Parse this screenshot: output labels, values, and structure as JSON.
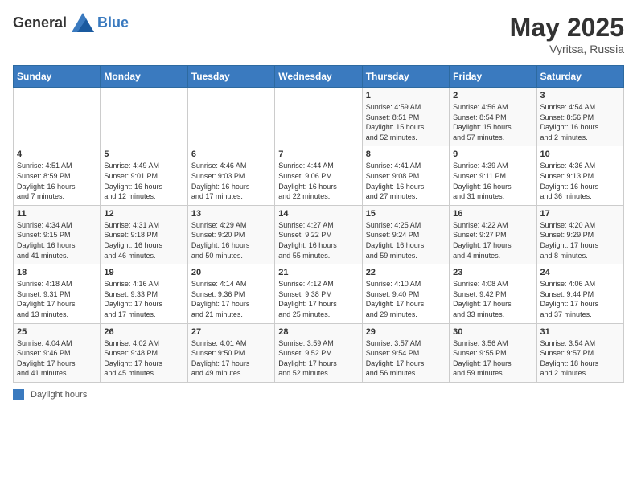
{
  "header": {
    "logo_general": "General",
    "logo_blue": "Blue",
    "title": "May 2025",
    "subtitle": "Vyritsa, Russia"
  },
  "weekdays": [
    "Sunday",
    "Monday",
    "Tuesday",
    "Wednesday",
    "Thursday",
    "Friday",
    "Saturday"
  ],
  "weeks": [
    [
      {
        "day": "",
        "info": ""
      },
      {
        "day": "",
        "info": ""
      },
      {
        "day": "",
        "info": ""
      },
      {
        "day": "",
        "info": ""
      },
      {
        "day": "1",
        "info": "Sunrise: 4:59 AM\nSunset: 8:51 PM\nDaylight: 15 hours\nand 52 minutes."
      },
      {
        "day": "2",
        "info": "Sunrise: 4:56 AM\nSunset: 8:54 PM\nDaylight: 15 hours\nand 57 minutes."
      },
      {
        "day": "3",
        "info": "Sunrise: 4:54 AM\nSunset: 8:56 PM\nDaylight: 16 hours\nand 2 minutes."
      }
    ],
    [
      {
        "day": "4",
        "info": "Sunrise: 4:51 AM\nSunset: 8:59 PM\nDaylight: 16 hours\nand 7 minutes."
      },
      {
        "day": "5",
        "info": "Sunrise: 4:49 AM\nSunset: 9:01 PM\nDaylight: 16 hours\nand 12 minutes."
      },
      {
        "day": "6",
        "info": "Sunrise: 4:46 AM\nSunset: 9:03 PM\nDaylight: 16 hours\nand 17 minutes."
      },
      {
        "day": "7",
        "info": "Sunrise: 4:44 AM\nSunset: 9:06 PM\nDaylight: 16 hours\nand 22 minutes."
      },
      {
        "day": "8",
        "info": "Sunrise: 4:41 AM\nSunset: 9:08 PM\nDaylight: 16 hours\nand 27 minutes."
      },
      {
        "day": "9",
        "info": "Sunrise: 4:39 AM\nSunset: 9:11 PM\nDaylight: 16 hours\nand 31 minutes."
      },
      {
        "day": "10",
        "info": "Sunrise: 4:36 AM\nSunset: 9:13 PM\nDaylight: 16 hours\nand 36 minutes."
      }
    ],
    [
      {
        "day": "11",
        "info": "Sunrise: 4:34 AM\nSunset: 9:15 PM\nDaylight: 16 hours\nand 41 minutes."
      },
      {
        "day": "12",
        "info": "Sunrise: 4:31 AM\nSunset: 9:18 PM\nDaylight: 16 hours\nand 46 minutes."
      },
      {
        "day": "13",
        "info": "Sunrise: 4:29 AM\nSunset: 9:20 PM\nDaylight: 16 hours\nand 50 minutes."
      },
      {
        "day": "14",
        "info": "Sunrise: 4:27 AM\nSunset: 9:22 PM\nDaylight: 16 hours\nand 55 minutes."
      },
      {
        "day": "15",
        "info": "Sunrise: 4:25 AM\nSunset: 9:24 PM\nDaylight: 16 hours\nand 59 minutes."
      },
      {
        "day": "16",
        "info": "Sunrise: 4:22 AM\nSunset: 9:27 PM\nDaylight: 17 hours\nand 4 minutes."
      },
      {
        "day": "17",
        "info": "Sunrise: 4:20 AM\nSunset: 9:29 PM\nDaylight: 17 hours\nand 8 minutes."
      }
    ],
    [
      {
        "day": "18",
        "info": "Sunrise: 4:18 AM\nSunset: 9:31 PM\nDaylight: 17 hours\nand 13 minutes."
      },
      {
        "day": "19",
        "info": "Sunrise: 4:16 AM\nSunset: 9:33 PM\nDaylight: 17 hours\nand 17 minutes."
      },
      {
        "day": "20",
        "info": "Sunrise: 4:14 AM\nSunset: 9:36 PM\nDaylight: 17 hours\nand 21 minutes."
      },
      {
        "day": "21",
        "info": "Sunrise: 4:12 AM\nSunset: 9:38 PM\nDaylight: 17 hours\nand 25 minutes."
      },
      {
        "day": "22",
        "info": "Sunrise: 4:10 AM\nSunset: 9:40 PM\nDaylight: 17 hours\nand 29 minutes."
      },
      {
        "day": "23",
        "info": "Sunrise: 4:08 AM\nSunset: 9:42 PM\nDaylight: 17 hours\nand 33 minutes."
      },
      {
        "day": "24",
        "info": "Sunrise: 4:06 AM\nSunset: 9:44 PM\nDaylight: 17 hours\nand 37 minutes."
      }
    ],
    [
      {
        "day": "25",
        "info": "Sunrise: 4:04 AM\nSunset: 9:46 PM\nDaylight: 17 hours\nand 41 minutes."
      },
      {
        "day": "26",
        "info": "Sunrise: 4:02 AM\nSunset: 9:48 PM\nDaylight: 17 hours\nand 45 minutes."
      },
      {
        "day": "27",
        "info": "Sunrise: 4:01 AM\nSunset: 9:50 PM\nDaylight: 17 hours\nand 49 minutes."
      },
      {
        "day": "28",
        "info": "Sunrise: 3:59 AM\nSunset: 9:52 PM\nDaylight: 17 hours\nand 52 minutes."
      },
      {
        "day": "29",
        "info": "Sunrise: 3:57 AM\nSunset: 9:54 PM\nDaylight: 17 hours\nand 56 minutes."
      },
      {
        "day": "30",
        "info": "Sunrise: 3:56 AM\nSunset: 9:55 PM\nDaylight: 17 hours\nand 59 minutes."
      },
      {
        "day": "31",
        "info": "Sunrise: 3:54 AM\nSunset: 9:57 PM\nDaylight: 18 hours\nand 2 minutes."
      }
    ]
  ],
  "legend": {
    "label": "Daylight hours"
  }
}
